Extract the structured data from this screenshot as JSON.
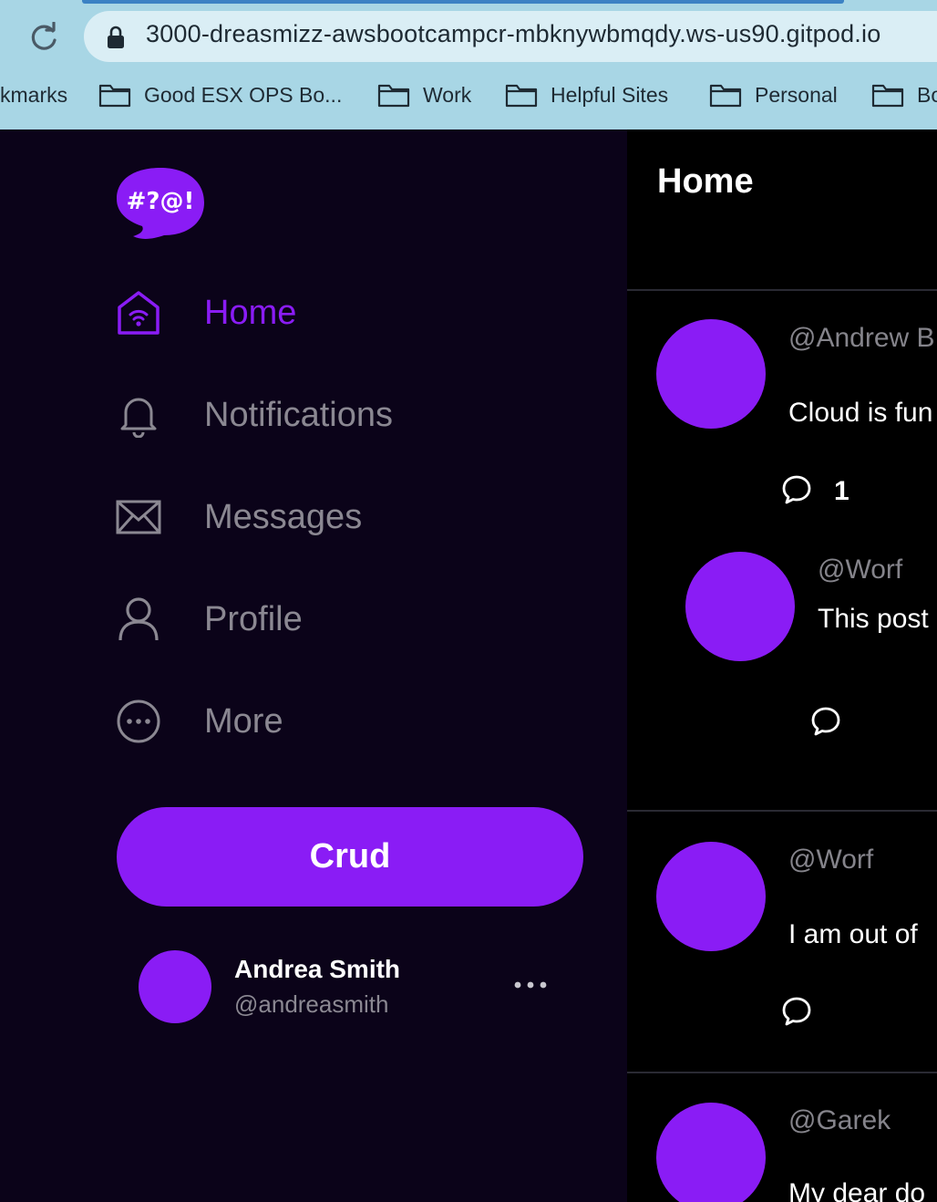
{
  "browser": {
    "url": "3000-dreasmizz-awsbootcampcr-mbknywbmqdy.ws-us90.gitpod.io",
    "bookmarks": [
      {
        "label": "kmarks"
      },
      {
        "label": "Good ESX OPS Bo..."
      },
      {
        "label": "Work"
      },
      {
        "label": "Helpful Sites"
      },
      {
        "label": "Personal"
      },
      {
        "label": "Bo"
      }
    ]
  },
  "logo": {
    "text": "#?@!"
  },
  "nav": {
    "items": [
      {
        "label": "Home",
        "icon": "home-icon",
        "active": true
      },
      {
        "label": "Notifications",
        "icon": "bell-icon"
      },
      {
        "label": "Messages",
        "icon": "envelope-icon"
      },
      {
        "label": "Profile",
        "icon": "person-icon"
      },
      {
        "label": "More",
        "icon": "more-circle-icon"
      }
    ]
  },
  "crud_button": {
    "label": "Crud"
  },
  "user": {
    "name": "Andrea Smith",
    "handle": "@andreasmith"
  },
  "feed": {
    "title": "Home",
    "activities": [
      {
        "handle": "@Andrew B",
        "message": "Cloud is fun",
        "replies_count": "1",
        "reply": {
          "handle": "@Worf",
          "message": "This post"
        }
      },
      {
        "handle": "@Worf",
        "message": "I am out of"
      },
      {
        "handle": "@Garek",
        "message": "My dear do"
      }
    ]
  },
  "colors": {
    "accent": "#8a1cf5",
    "sidebar_bg": "#0b0319",
    "feed_bg": "#000000",
    "muted_text": "#8b8892"
  }
}
